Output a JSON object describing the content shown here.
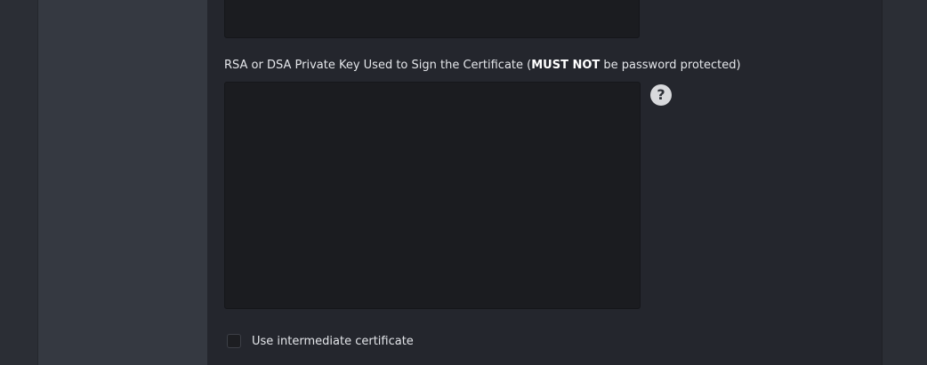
{
  "private_key_field": {
    "label_before": "RSA or DSA Private Key Used to Sign the Certificate (",
    "label_emphasis": "MUST NOT",
    "label_after": " be password protected)",
    "value": ""
  },
  "help_icon": {
    "glyph": "?",
    "icon": "question-mark-icon"
  },
  "intermediate_certificate": {
    "label": "Use intermediate certificate",
    "checked": false
  }
}
